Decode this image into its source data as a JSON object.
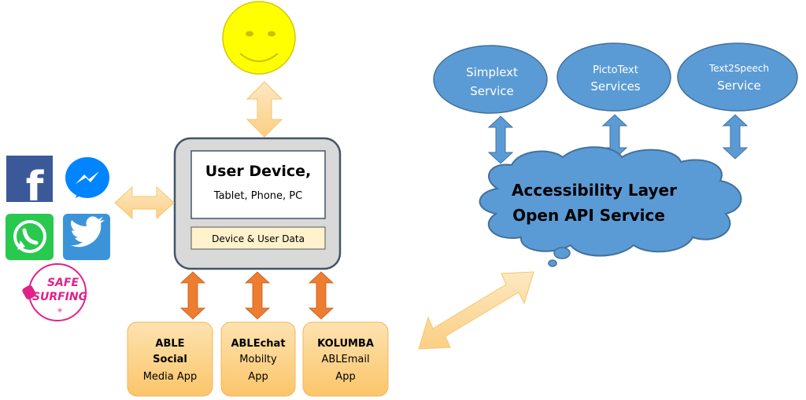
{
  "user": {
    "label": "user-smiley"
  },
  "device": {
    "title": "User Device,",
    "subtitle": "Tablet, Phone, PC",
    "data_label": "Device & User Data"
  },
  "social_icons": {
    "facebook": "f",
    "safe_surfing_line1": "SAFE",
    "safe_surfing_line2": "SURFING"
  },
  "apps": [
    {
      "line1": "ABLE",
      "line2": "Social",
      "line3": "Media App"
    },
    {
      "line1": "ABLEchat",
      "line2": "Mobilty",
      "line3": "App"
    },
    {
      "line1": "KOLUMBA",
      "line2": "ABLEmail",
      "line3": "App"
    }
  ],
  "services": [
    {
      "line1": "Simplext",
      "line2": "Service"
    },
    {
      "line1": "PictoText",
      "line2": "Services"
    },
    {
      "line1": "Text2Speech",
      "line2": "Service"
    }
  ],
  "cloud": {
    "line1": "Accessibility Layer",
    "line2": "Open API Service"
  },
  "colors": {
    "smiley": "#ffff00",
    "device_bg": "#d9d9d9",
    "device_border": "#44546a",
    "data_bar": "#fff2cc",
    "app_box": "#fdd58a",
    "peach_arrow": "#fdd79a",
    "orange_arrow": "#ed7d31",
    "service_blue": "#5b9bd5",
    "service_border": "#41719c"
  }
}
